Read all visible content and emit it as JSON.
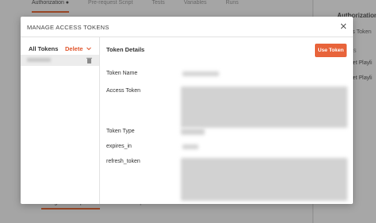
{
  "background": {
    "tabs": [
      "Authorization ●",
      "Pre-request Script",
      "Tests",
      "Variables",
      "Runs"
    ],
    "active_tab_index": 0,
    "right_panel": {
      "title": "Authorization",
      "subtitle": "Access Token",
      "caption": "IN THIS",
      "item1": "Get Playli",
      "item2": "Get Playli"
    },
    "bottom_tabs": [
      "Configuration Options ●",
      "Advanced Options"
    ]
  },
  "modal": {
    "title": "MANAGE ACCESS TOKENS",
    "sidebar": {
      "all_tokens_label": "All Tokens",
      "delete_label": "Delete"
    },
    "details": {
      "title": "Token Details",
      "use_token_label": "Use Token",
      "fields": [
        {
          "label": "Token Name"
        },
        {
          "label": "Access Token"
        },
        {
          "label": "Token Type"
        },
        {
          "label": "expires_in"
        },
        {
          "label": "refresh_token"
        }
      ]
    }
  },
  "colors": {
    "accent": "#e8643b",
    "delete": "#e0542b"
  }
}
